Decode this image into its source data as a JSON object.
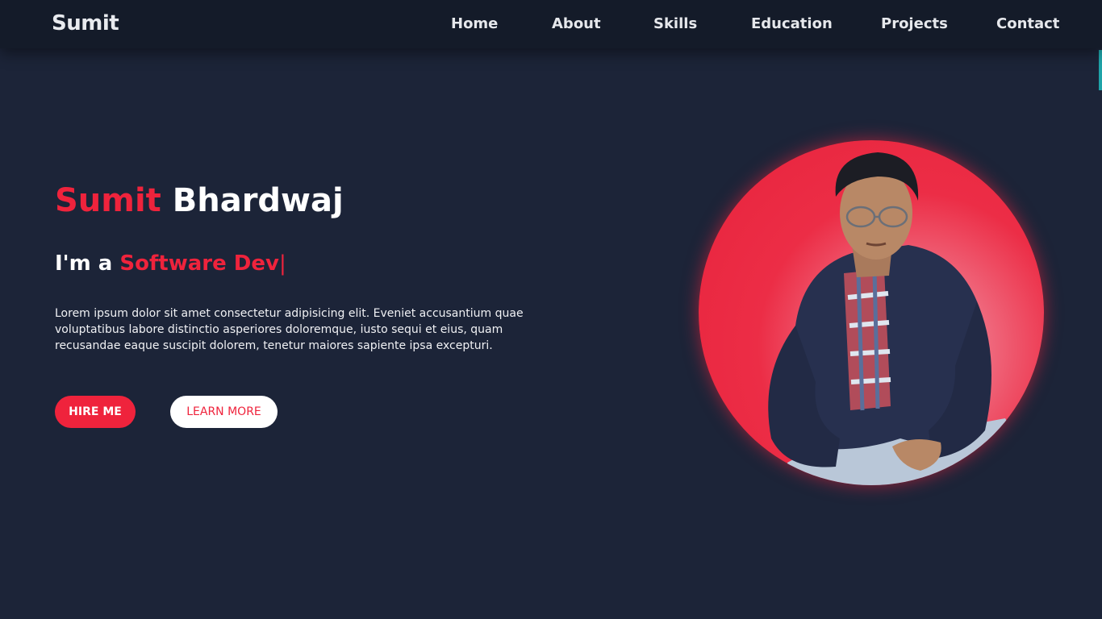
{
  "brand": "Sumit",
  "nav": {
    "items": [
      {
        "label": "Home"
      },
      {
        "label": "About"
      },
      {
        "label": "Skills"
      },
      {
        "label": "Education"
      },
      {
        "label": "Projects"
      },
      {
        "label": "Contact"
      }
    ]
  },
  "hero": {
    "first_name": "Sumit",
    "last_name": "Bhardwaj",
    "role_prefix": "I'm a",
    "role": "Software Dev",
    "cursor": "|",
    "description": "Lorem ipsum dolor sit amet consectetur adipisicing elit. Eveniet accusantium quae voluptatibus labore distinctio asperiores doloremque, iusto sequi et eius, quam recusandae eaque suscipit dolorem, tenetur maiores sapiente ipsa excepturi.",
    "buttons": {
      "hire": "HIRE ME",
      "learn": "LEARN MORE"
    }
  },
  "colors": {
    "accent": "#ef233c",
    "background": "#1c2438",
    "navbar": "#141b29"
  },
  "icons": {
    "portrait": "profile-photo"
  }
}
